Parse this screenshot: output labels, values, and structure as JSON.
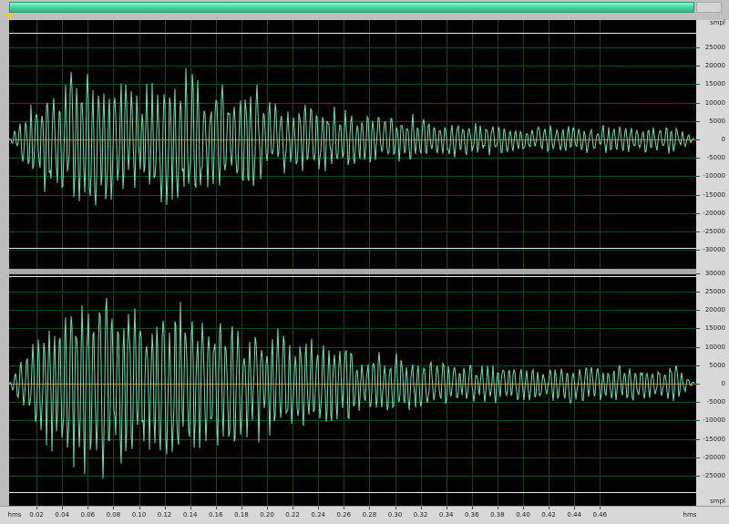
{
  "colors": {
    "waveform": "#5fe7b6",
    "grid": "#0d4a1c",
    "clip_line": "#e8e8e8",
    "background": "#000000",
    "center_line": "#a06a3a"
  },
  "icons": {
    "playhead": "triangle-down-icon"
  },
  "units": {
    "amplitude": "smpl",
    "time": "hms"
  },
  "amplitude_ticks": {
    "top_channel": [
      "25000",
      "20000",
      "15000",
      "10000",
      "5000",
      "0",
      "-5000",
      "-10000",
      "-15000",
      "-20000",
      "-25000",
      "-30000"
    ],
    "bottom_channel": [
      "30000",
      "25000",
      "20000",
      "15000",
      "10000",
      "5000",
      "0",
      "-5000",
      "-10000",
      "-15000",
      "-20000",
      "-25000"
    ]
  },
  "time_ticks": [
    "0.02",
    "0.04",
    "0.06",
    "0.08",
    "0.10",
    "0.12",
    "0.14",
    "0.16",
    "0.18",
    "0.20",
    "0.22",
    "0.24",
    "0.26",
    "0.28",
    "0.30",
    "0.32",
    "0.34",
    "0.36",
    "0.38",
    "0.40",
    "0.42",
    "0.44",
    "0.46"
  ]
}
